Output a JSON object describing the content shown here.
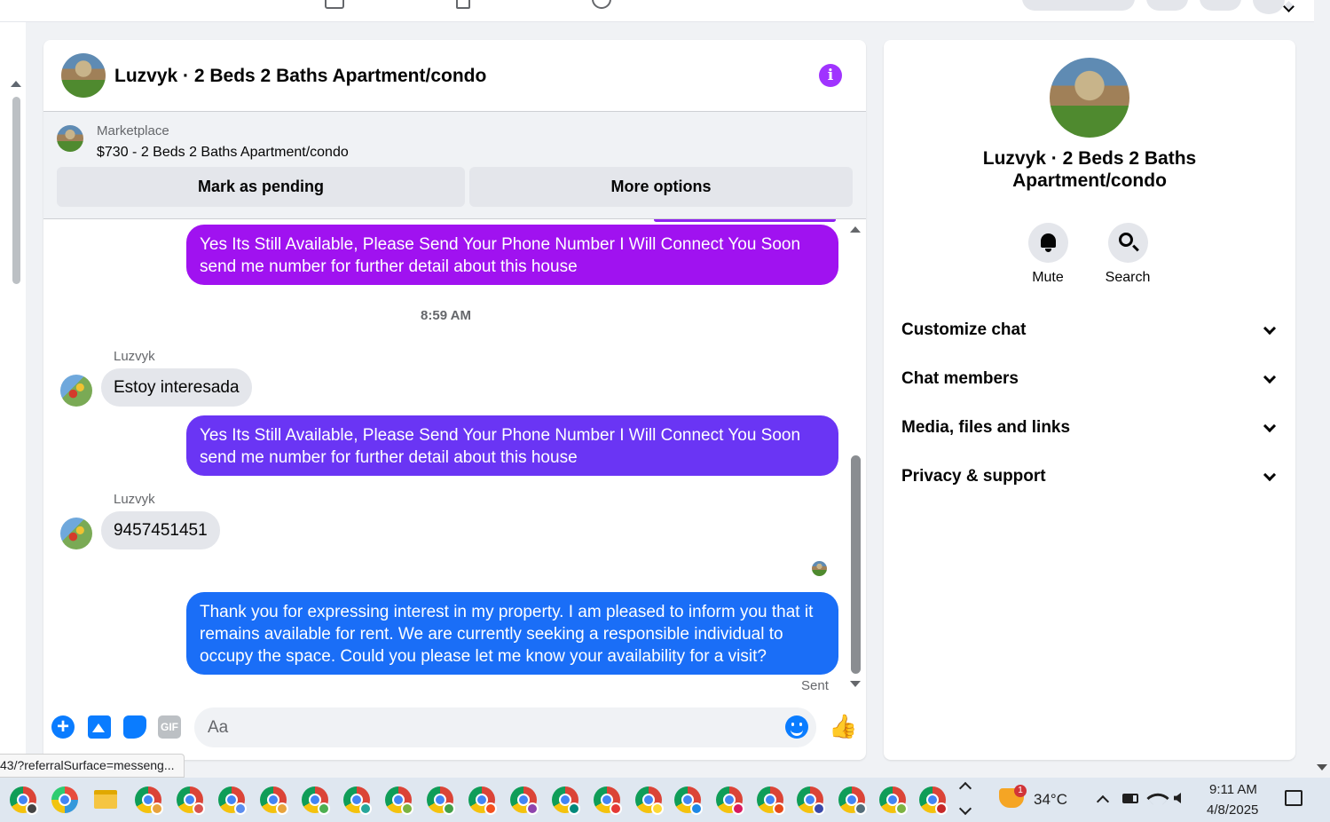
{
  "chat": {
    "title": "Luzvyk · 2 Beds 2 Baths Apartment/condo",
    "marketplace_label": "Marketplace",
    "listing": "$730 - 2 Beds 2 Baths Apartment/condo",
    "btn_pending": "Mark as pending",
    "btn_more": "More options",
    "info_icon_text": "i"
  },
  "messages": {
    "out1": "Yes Its Still Available, Please Send Your Phone Number I Will Connect You Soon send me number for further detail about this house",
    "timestamp": "8:59 AM",
    "sender1": "Luzvyk",
    "in1": "Estoy interesada",
    "out2": "Yes Its Still Available, Please Send Your Phone Number I Will Connect You Soon send me number for further detail about this house",
    "sender2": "Luzvyk",
    "in2": "9457451451",
    "out3": "Thank you for expressing interest in my property. I am pleased to inform you that it remains available for rent. We are currently seeking a responsible individual to occupy the space. Could you please let me know your availability for a visit?",
    "status": "Sent"
  },
  "composer": {
    "placeholder": "Aa",
    "gif_label": "GIF",
    "plus_label": "+",
    "like_glyph": "👍"
  },
  "side": {
    "title": "Luzvyk · 2 Beds 2 Baths Apartment/condo",
    "mute_label": "Mute",
    "search_label": "Search",
    "sections": [
      "Customize chat",
      "Chat members",
      "Media, files and links",
      "Privacy & support"
    ]
  },
  "status_url": "43/?referralSurface=messeng...",
  "taskbar": {
    "weather_badge": "1",
    "temperature": "34°C",
    "time": "9:11 AM",
    "date": "4/8/2025"
  },
  "colors": {
    "bubble_purple": "#a012f0",
    "bubble_violet": "#6a35f4",
    "bubble_blue": "#1a6ef7",
    "accent": "#0a7cff",
    "info": "#a033ff"
  }
}
